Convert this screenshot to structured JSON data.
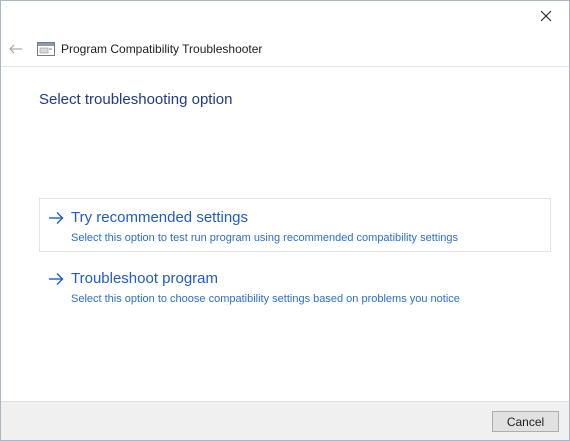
{
  "window": {
    "close_icon": "close-icon"
  },
  "nav": {
    "back_icon": "back-arrow-icon",
    "app_icon": "program-compatibility-icon",
    "title": "Program Compatibility Troubleshooter"
  },
  "main": {
    "heading": "Select troubleshooting option",
    "options": [
      {
        "icon": "arrow-right-icon",
        "title": "Try recommended settings",
        "description": "Select this option to test run program using recommended compatibility settings"
      },
      {
        "icon": "arrow-right-icon",
        "title": "Troubleshoot program",
        "description": "Select this option to choose compatibility settings based on problems you notice"
      }
    ]
  },
  "footer": {
    "cancel_label": "Cancel"
  },
  "colors": {
    "heading": "#1f3a8a",
    "option_title": "#1e5cc4",
    "option_desc": "#2b6fcf",
    "footer_bg": "#f0f0f0"
  }
}
